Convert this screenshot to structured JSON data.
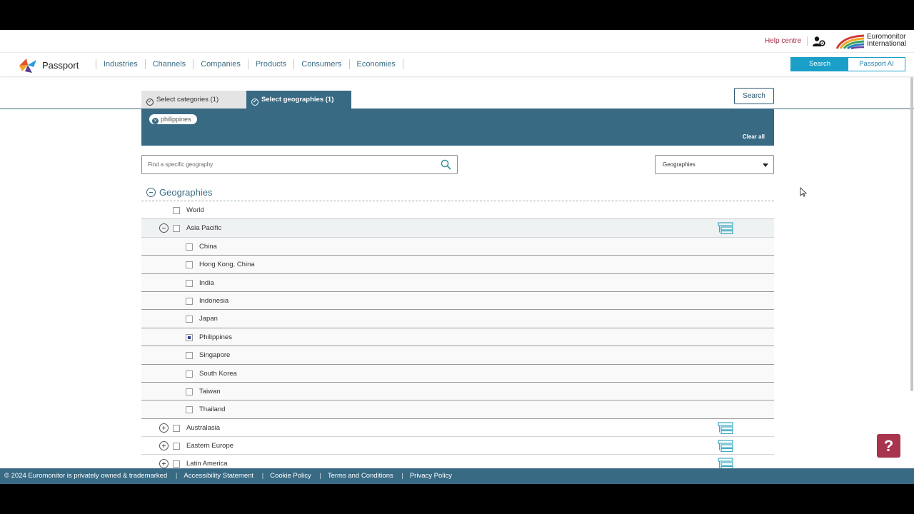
{
  "utility": {
    "help_centre": "Help centre",
    "brand_line1": "Euromonitor",
    "brand_line2": "International"
  },
  "nav": {
    "brand": "Passport",
    "items": [
      "Industries",
      "Channels",
      "Companies",
      "Products",
      "Consumers",
      "Economies"
    ],
    "mode_search": "Search",
    "mode_ai": "Passport AI"
  },
  "tabs": {
    "categories": "Select categories (1)",
    "geographies": "Select geographies (1)",
    "search_button": "Search"
  },
  "selection": {
    "chips": [
      "philippines"
    ],
    "clear_all": "Clear all"
  },
  "filter": {
    "placeholder": "Find a specific geography",
    "dropdown_value": "Geographies"
  },
  "tree": {
    "heading": "Geographies",
    "world": "World",
    "asia_pacific": "Asia Pacific",
    "asia_children": [
      {
        "label": "China",
        "checked": false
      },
      {
        "label": "Hong Kong, China",
        "checked": false
      },
      {
        "label": "India",
        "checked": false
      },
      {
        "label": "Indonesia",
        "checked": false
      },
      {
        "label": "Japan",
        "checked": false
      },
      {
        "label": "Philippines",
        "checked": true
      },
      {
        "label": "Singapore",
        "checked": false
      },
      {
        "label": "South Korea",
        "checked": false
      },
      {
        "label": "Taiwan",
        "checked": false
      },
      {
        "label": "Thailand",
        "checked": false
      }
    ],
    "regions": [
      "Australasia",
      "Eastern Europe",
      "Latin America"
    ]
  },
  "help_button": "?",
  "footer": {
    "copyright": "© 2024 Euromonitor is privately owned & trademarked",
    "links": [
      "Accessibility Statement",
      "Cookie Policy",
      "Terms and Conditions",
      "Privacy Policy"
    ]
  },
  "colors": {
    "accent": "#386a84",
    "brand_red": "#a8344d",
    "toggle_blue": "#1a9fc9"
  }
}
